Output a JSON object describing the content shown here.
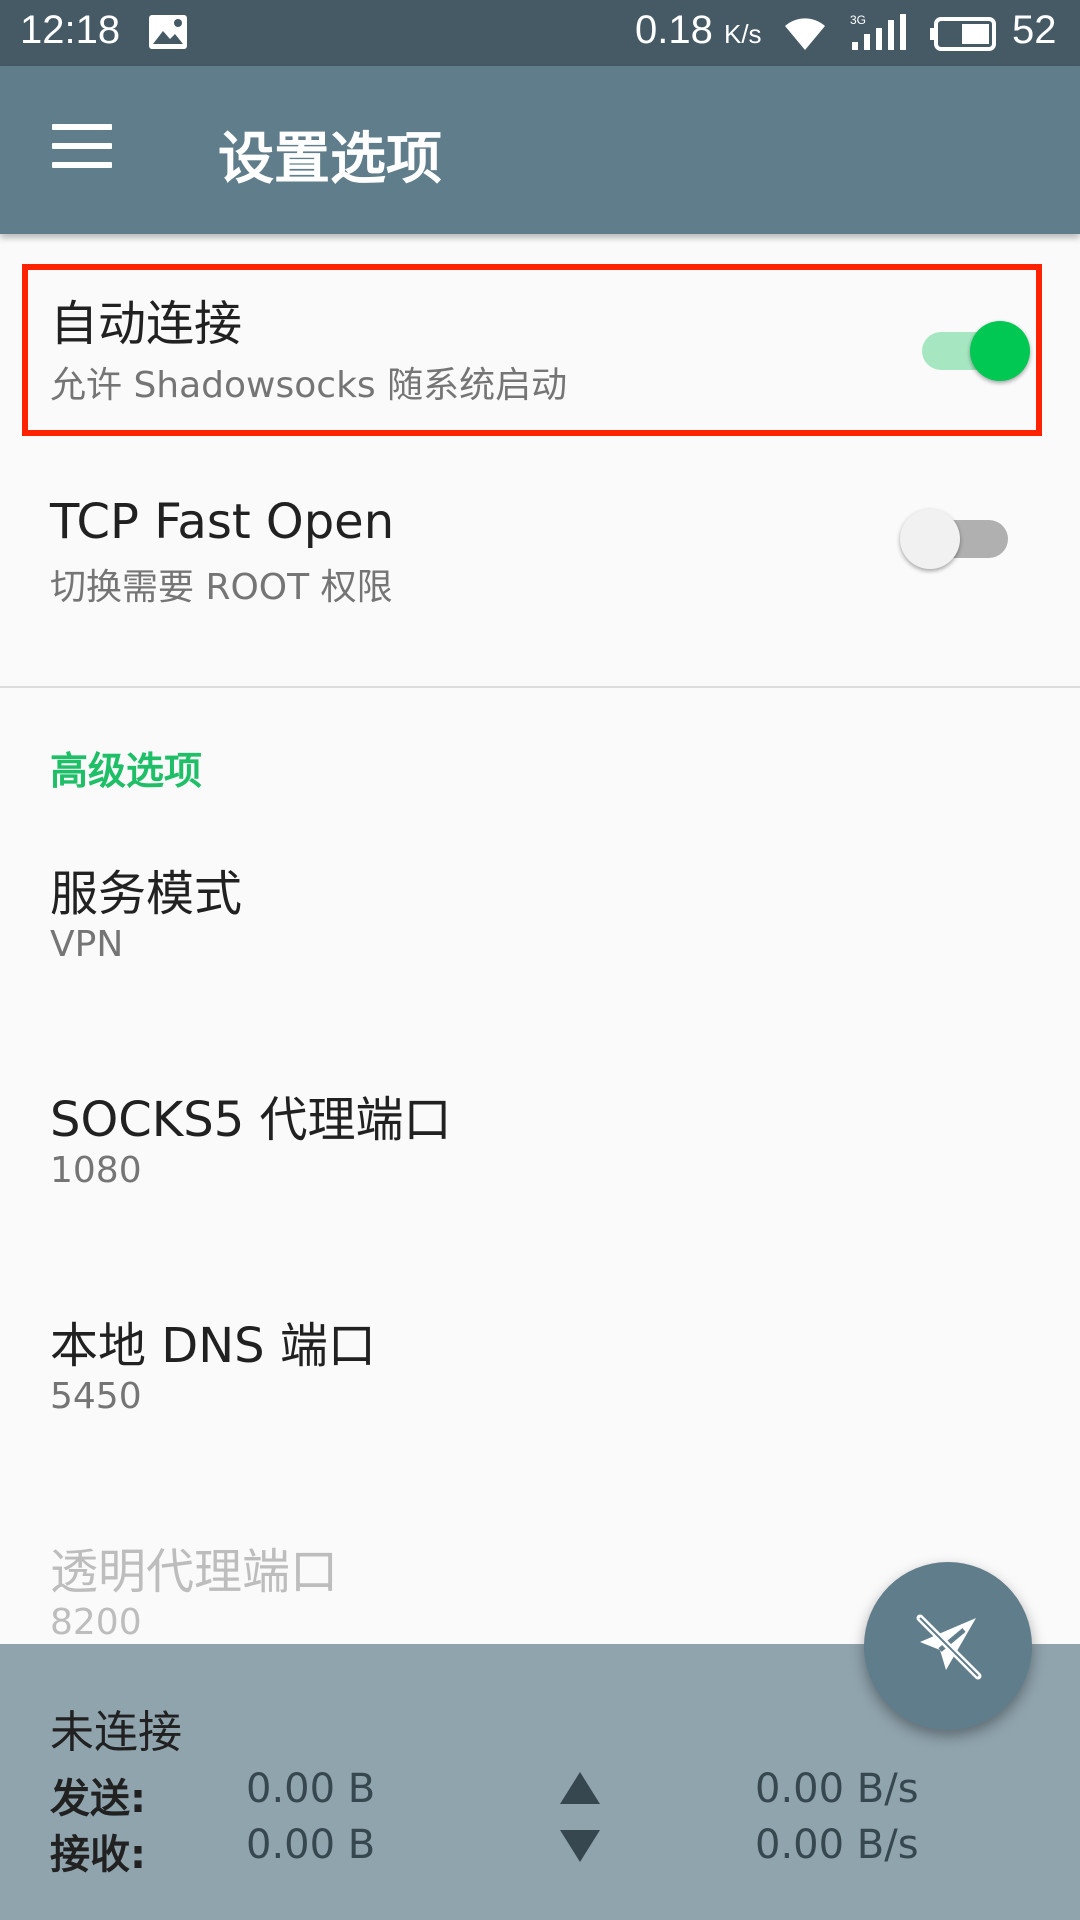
{
  "status_bar": {
    "time": "12:18",
    "net_speed": "0.18",
    "net_speed_unit": "K/s",
    "network_type": "3G",
    "battery": "52"
  },
  "toolbar": {
    "menu_icon": "menu-icon",
    "title": "设置选项"
  },
  "prefs": {
    "auto_connect": {
      "title": "自动连接",
      "summary": "允许 Shadowsocks 随系统启动",
      "enabled": true
    },
    "tcp_fast_open": {
      "title": "TCP Fast Open",
      "summary": "切换需要 ROOT 权限",
      "enabled": false
    },
    "advanced_header": "高级选项",
    "service_mode": {
      "title": "服务模式",
      "summary": "VPN"
    },
    "socks5_port": {
      "title": "SOCKS5 代理端口",
      "summary": "1080"
    },
    "local_dns_port": {
      "title": "本地 DNS 端口",
      "summary": "5450"
    },
    "transparent_proxy_port": {
      "title": "透明代理端口",
      "summary": "8200"
    }
  },
  "stats": {
    "status": "未连接",
    "send_label": "发送:",
    "send_total": "0.00 B",
    "send_rate": "0.00 B/s",
    "receive_label": "接收:",
    "receive_total": "0.00 B",
    "receive_rate": "0.00 B/s"
  },
  "fab": {
    "icon": "paper-plane-off-icon"
  },
  "colors": {
    "toolbar": "#607d8b",
    "status_bar": "#455a64",
    "accent": "#00c853",
    "highlight_border": "#ff2200",
    "bottom_panel": "#90a4ae"
  }
}
